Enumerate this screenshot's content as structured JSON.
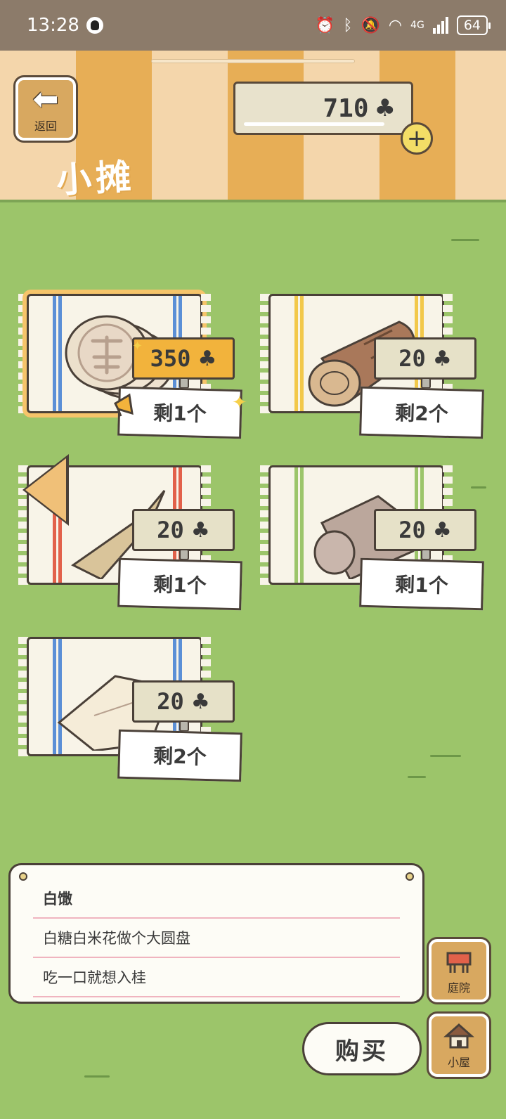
{
  "status_bar": {
    "time": "13:28",
    "network": "4G",
    "battery": "64"
  },
  "header": {
    "back_label": "返回",
    "title": "小摊",
    "coins": "710",
    "clover_symbol": "♣"
  },
  "items": [
    {
      "price": "350",
      "stock": "剩1个",
      "selected": true,
      "stripe_color": "#5b8fd6"
    },
    {
      "price": "20",
      "stock": "剩2个",
      "selected": false,
      "stripe_color": "#f2c84a"
    },
    {
      "price": "20",
      "stock": "剩1个",
      "selected": false,
      "stripe_color": "#e2614a"
    },
    {
      "price": "20",
      "stock": "剩1个",
      "selected": false,
      "stripe_color": "#9cc56a"
    },
    {
      "price": "20",
      "stock": "剩2个",
      "selected": false,
      "stripe_color": "#5b8fd6"
    }
  ],
  "description": {
    "name": "白馓",
    "line1": "白糖白米花做个大圆盘",
    "line2": "吃一口就想入桂"
  },
  "buttons": {
    "buy": "购买",
    "yard": "庭院",
    "house": "小屋"
  }
}
